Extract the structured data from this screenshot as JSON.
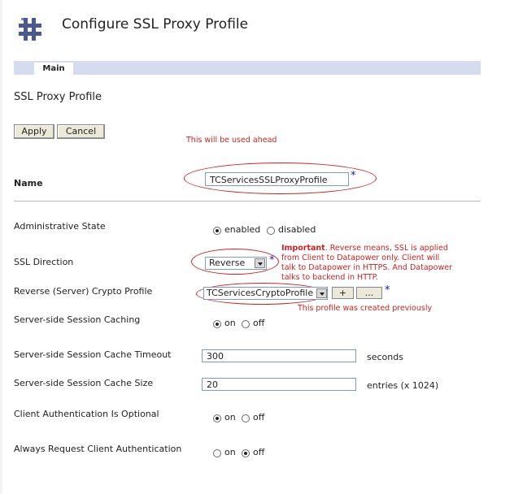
{
  "page": {
    "title": "Configure SSL Proxy Profile"
  },
  "tabs": [
    {
      "label": "Main"
    }
  ],
  "section": {
    "title": "SSL Proxy Profile"
  },
  "buttons": {
    "apply": "Apply",
    "cancel": "Cancel",
    "plus": "+",
    "browse": "..."
  },
  "notes": {
    "used_ahead": "This will be used ahead",
    "important_bold": "Important",
    "important_lines": [
      ". Reverse means, SSL is applied",
      "from Client to Datapower only. Client will",
      "talk to Datapower in HTTPS. And Datapower",
      "talks to backend in HTTP."
    ],
    "created_previously": "This profile was created previously"
  },
  "fields": {
    "name": {
      "label": "Name",
      "value": "TCServicesSSLProxyProfile",
      "required": "*"
    },
    "admin_state": {
      "label": "Administrative State",
      "options": [
        "enabled",
        "disabled"
      ],
      "selected": "enabled"
    },
    "ssl_direction": {
      "label": "SSL Direction",
      "value": "Reverse",
      "required": "*"
    },
    "crypto_profile": {
      "label": "Reverse (Server) Crypto Profile",
      "value": "TCServicesCryptoProfile",
      "required": "*"
    },
    "session_caching": {
      "label": "Server-side Session Caching",
      "options": [
        "on",
        "off"
      ],
      "selected": "on"
    },
    "cache_timeout": {
      "label": "Server-side Session Cache Timeout",
      "value": "300",
      "unit": "seconds"
    },
    "cache_size": {
      "label": "Server-side Session Cache Size",
      "value": "20",
      "unit": "entries (x 1024)"
    },
    "client_auth_optional": {
      "label": "Client Authentication Is Optional",
      "options": [
        "on",
        "off"
      ],
      "selected": "on"
    },
    "always_request": {
      "label": "Always Request Client Authentication",
      "options": [
        "on",
        "off"
      ],
      "selected": "off"
    }
  },
  "colors": {
    "annotation": "#cc2222",
    "tab_bar": "#d6dcef",
    "required": "#1a1aa8"
  }
}
